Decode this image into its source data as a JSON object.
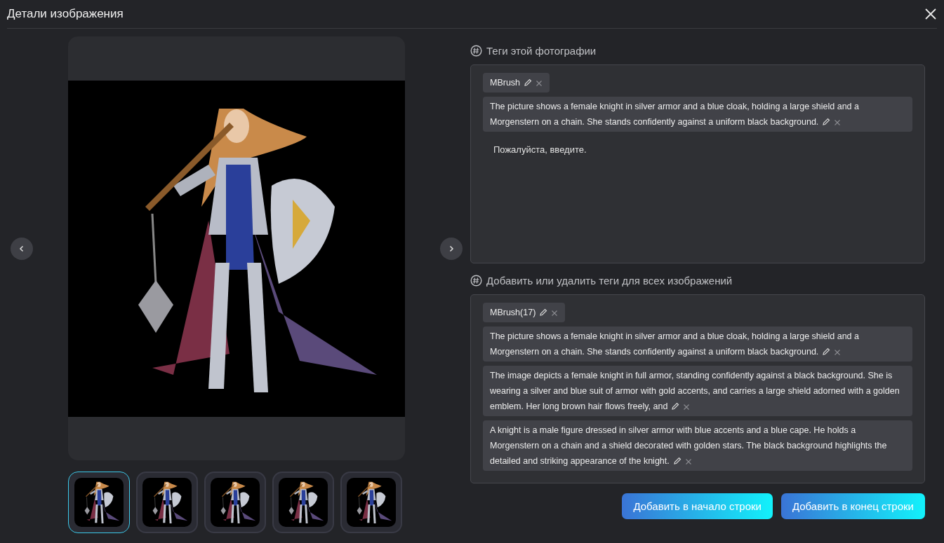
{
  "window": {
    "title": "Детали изображения"
  },
  "viewer": {
    "image": {
      "kind": "picture"
    },
    "thumbnails": [
      {
        "kind": "picture",
        "selected": true
      },
      {
        "kind": "picture",
        "selected": false
      },
      {
        "kind": "picture",
        "selected": false
      },
      {
        "kind": "picture",
        "selected": false
      },
      {
        "kind": "picture",
        "selected": false
      }
    ]
  },
  "photo_tags": {
    "label": "Теги этой фотографии",
    "tags": [
      {
        "text": "MBrush"
      },
      {
        "text": "The picture shows a female knight in silver armor and a blue cloak, holding a large shield and a Morgenstern on a chain. She stands confidently against a uniform black background."
      }
    ],
    "input": {
      "placeholder": "Пожалуйста, введите."
    }
  },
  "all_tags": {
    "label": "Добавить или удалить теги для всех изображений",
    "tags": [
      {
        "text": "MBrush(17)"
      },
      {
        "text": "The picture shows a female knight in silver armor and a blue cloak, holding a large shield and a Morgenstern on a chain. She stands confidently against a uniform black background."
      },
      {
        "text": "The image depicts a female knight in full armor, standing confidently against a black background. She is wearing a silver and blue suit of armor with gold accents, and carries a large shield adorned with a golden emblem. Her long brown hair flows freely, and"
      },
      {
        "text": "A knight is a male figure dressed in silver armor with blue accents and a blue cape. He holds a Morgenstern on a chain and a shield decorated with golden stars. The black background highlights the detailed and striking appearance of the knight."
      }
    ]
  },
  "buttons": [
    "Добавить в начало строки",
    "Добавить в конец строки"
  ]
}
